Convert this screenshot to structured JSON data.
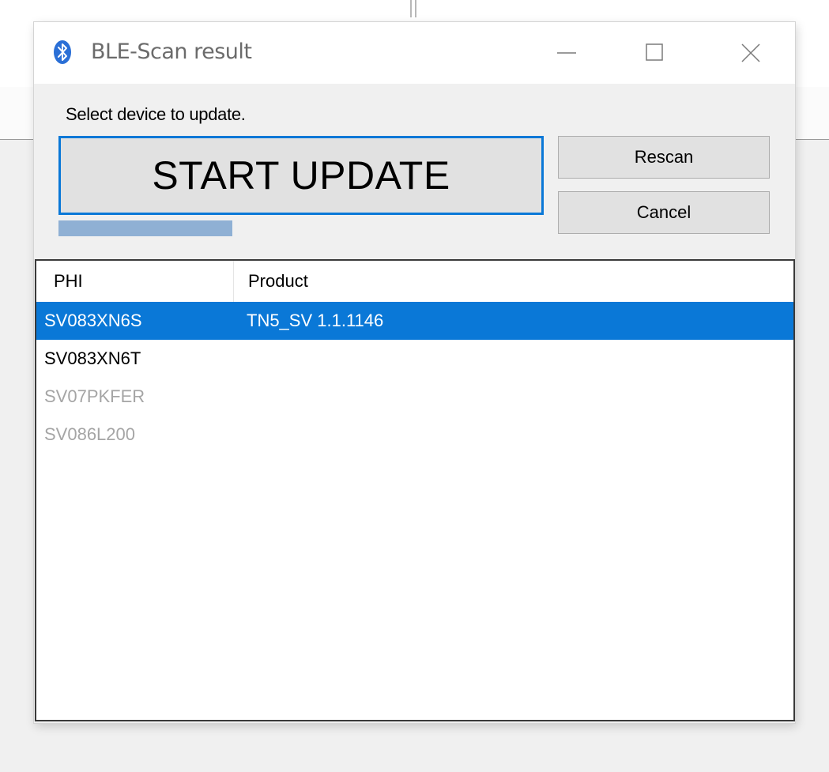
{
  "window": {
    "title": "BLE-Scan result",
    "icon": "bluetooth-icon",
    "controls": [
      "minimize-icon",
      "maximize-icon",
      "close-icon"
    ]
  },
  "prompt": "Select device to update.",
  "buttons": {
    "start_update": "START UPDATE",
    "rescan": "Rescan",
    "cancel": "Cancel"
  },
  "progress": {
    "value": 1.0
  },
  "list": {
    "columns": [
      "PHI",
      "Product"
    ],
    "rows": [
      {
        "phi": "SV083XN6S",
        "product": "TN5_SV 1.1.1146",
        "state": "selected"
      },
      {
        "phi": "SV083XN6T",
        "product": "",
        "state": "normal"
      },
      {
        "phi": "SV07PKFER",
        "product": "",
        "state": "dim"
      },
      {
        "phi": "SV086L200",
        "product": "",
        "state": "dim"
      }
    ]
  },
  "colors": {
    "accent": "#0A78D7",
    "selected_text": "#FFFFFF",
    "dim_text": "#A5A5A5",
    "progress": "#8FB0D4"
  }
}
